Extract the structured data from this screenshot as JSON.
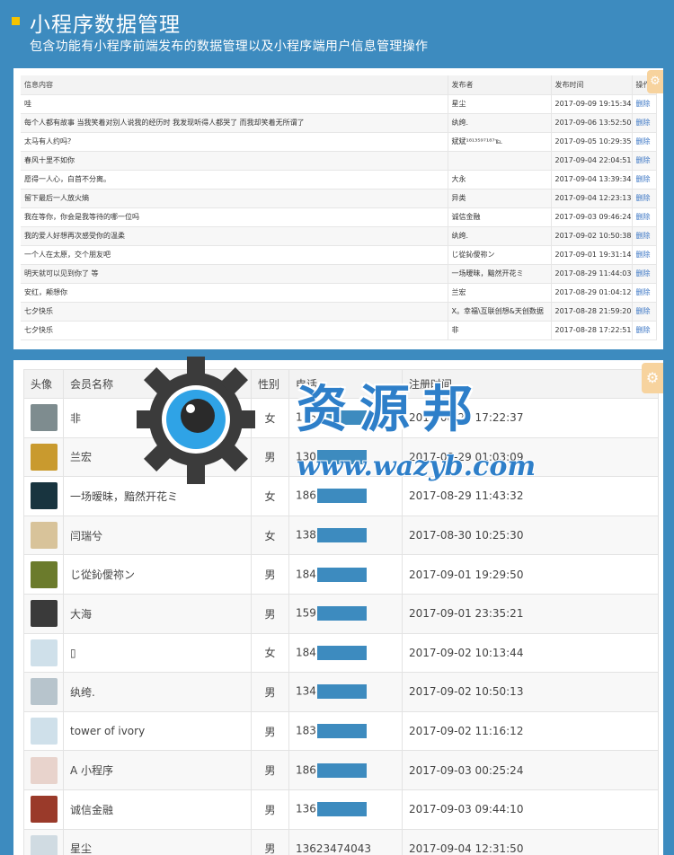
{
  "header": {
    "title": "小程序数据管理",
    "subtitle": "包含功能有小程序前端发布的数据管理以及小程序端用户信息管理操作"
  },
  "messages": {
    "columns": [
      "信息内容",
      "发布者",
      "发布时间",
      "操作"
    ],
    "rows": [
      {
        "content": "哇",
        "author": "星尘",
        "time": "2017-09-09 19:15:34",
        "action": "删除"
      },
      {
        "content": "每个人都有故事 当我笑着对别人说我的经历时 我发现听得人都哭了 而我却笑着无所谓了",
        "author": "纨绔.",
        "time": "2017-09-06 13:52:50",
        "action": "删除"
      },
      {
        "content": "太马有人约吗？",
        "author": "斌斌¹⁸¹³⁵⁹⁷¹⁸⁷℡",
        "time": "2017-09-05 10:29:35",
        "action": "删除"
      },
      {
        "content": "春风十里不如你",
        "author": "",
        "time": "2017-09-04 22:04:51",
        "action": "删除"
      },
      {
        "content": "愿得一人心，白首不分离。",
        "author": "大永",
        "time": "2017-09-04 13:39:34",
        "action": "删除"
      },
      {
        "content": "留下最后一人放火熵",
        "author": "异类",
        "time": "2017-09-04 12:23:13",
        "action": "删除"
      },
      {
        "content": "我在等你，你会是我等待的哪一位吗",
        "author": "诚信金融",
        "time": "2017-09-03 09:46:24",
        "action": "删除"
      },
      {
        "content": "我的爱人好想再次感受你的温柔",
        "author": "纨绔.",
        "time": "2017-09-02 10:50:38",
        "action": "删除"
      },
      {
        "content": "一个人在太原，交个朋友吧",
        "author": "じ從鈊僾祢ン",
        "time": "2017-09-01 19:31:14",
        "action": "删除"
      },
      {
        "content": "明天就可以见到你了 等",
        "author": "一场暧昧，黯然开花ミ",
        "time": "2017-08-29 11:44:03",
        "action": "删除"
      },
      {
        "content": "安红，颠想你",
        "author": "兰宏",
        "time": "2017-08-29 01:04:12",
        "action": "删除"
      },
      {
        "content": "七夕快乐",
        "author": "X。幸福\\互联创想&天创数据",
        "time": "2017-08-28 21:59:20",
        "action": "删除"
      },
      {
        "content": "七夕快乐",
        "author": "非",
        "time": "2017-08-28 17:22:51",
        "action": "删除"
      }
    ]
  },
  "members": {
    "columns": [
      "头像",
      "会员名称",
      "性别",
      "电话",
      "注册时间"
    ],
    "rows": [
      {
        "avatar": "#7e8c8f",
        "name": "非",
        "gender": "女",
        "phone": "186",
        "time": "2017-08-28 17:22:37"
      },
      {
        "avatar": "#c99a2e",
        "name": "兰宏",
        "gender": "男",
        "phone": "130",
        "time": "2017-08-29 01:03:09"
      },
      {
        "avatar": "#18343f",
        "name": "一场暧昧，黯然开花ミ",
        "gender": "女",
        "phone": "186",
        "time": "2017-08-29 11:43:32"
      },
      {
        "avatar": "#d8c39a",
        "name": "闫瑞兮",
        "gender": "女",
        "phone": "138",
        "time": "2017-08-30 10:25:30"
      },
      {
        "avatar": "#6b7b2c",
        "name": "じ從鈊僾祢ン",
        "gender": "男",
        "phone": "184",
        "time": "2017-09-01 19:29:50"
      },
      {
        "avatar": "#3a3a3a",
        "name": "大海",
        "gender": "男",
        "phone": "159",
        "time": "2017-09-01 23:35:21"
      },
      {
        "avatar": "#cfe0ea",
        "name": "▯",
        "gender": "女",
        "phone": "184",
        "time": "2017-09-02 10:13:44"
      },
      {
        "avatar": "#b7c4cc",
        "name": "纨绔.",
        "gender": "男",
        "phone": "134",
        "time": "2017-09-02 10:50:13"
      },
      {
        "avatar": "#cfe0ea",
        "name": "tower of ivory",
        "gender": "男",
        "phone": "183",
        "time": "2017-09-02 11:16:12"
      },
      {
        "avatar": "#e8d3cc",
        "name": "A 小程序",
        "gender": "男",
        "phone": "186",
        "time": "2017-09-03 00:25:24"
      },
      {
        "avatar": "#9a3a2a",
        "name": "诚信金融",
        "gender": "男",
        "phone": "136",
        "time": "2017-09-03 09:44:10"
      },
      {
        "avatar": "#d0dbe2",
        "name": "星尘",
        "gender": "男",
        "phone": "13623474043",
        "time": "2017-09-04 12:31:50"
      }
    ]
  },
  "watermark": {
    "text": "资源邦",
    "url": "www.wazyb.com"
  },
  "colors": {
    "background": "#3d8bbf",
    "accent": "#f5c300",
    "link": "#3a75c4"
  }
}
